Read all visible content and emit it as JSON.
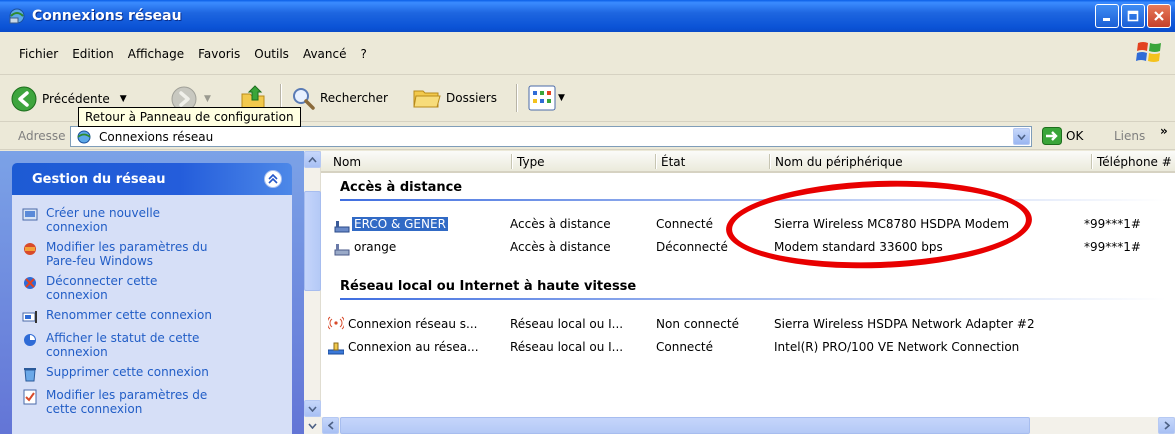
{
  "window": {
    "title": "Connexions réseau"
  },
  "menu": [
    "Fichier",
    "Edition",
    "Affichage",
    "Favoris",
    "Outils",
    "Avancé",
    "?"
  ],
  "toolbar": {
    "back_label": "Précédente",
    "search_label": "Rechercher",
    "folders_label": "Dossiers",
    "tooltip": "Retour à Panneau de configuration"
  },
  "address": {
    "label": "Adresse",
    "value": "Connexions réseau",
    "go_label": "OK",
    "links_label": "Liens",
    "more": "»"
  },
  "sidebar": {
    "title": "Gestion du réseau",
    "tasks": [
      {
        "label": "Créer une nouvelle connexion",
        "icon": "new-connection-icon"
      },
      {
        "label": "Modifier les paramètres du Pare-feu Windows",
        "icon": "firewall-icon"
      },
      {
        "label": "Déconnecter cette connexion",
        "icon": "disconnect-icon"
      },
      {
        "label": "Renommer cette connexion",
        "icon": "rename-icon"
      },
      {
        "label": "Afficher le statut de cette connexion",
        "icon": "status-icon"
      },
      {
        "label": "Supprimer cette connexion",
        "icon": "delete-icon"
      },
      {
        "label": "Modifier les paramètres de cette connexion",
        "icon": "settings-icon"
      }
    ]
  },
  "columns": [
    "Nom",
    "Type",
    "État",
    "Nom du périphérique",
    "Téléphone #"
  ],
  "groups": [
    {
      "title": "Accès à distance",
      "rows": [
        {
          "name": "ERCO & GENER",
          "type": "Accès à distance",
          "state": "Connecté",
          "device": "Sierra Wireless MC8780 HSDPA Modem",
          "phone": "*99***1#",
          "selected": true
        },
        {
          "name": "orange",
          "type": "Accès à distance",
          "state": "Déconnecté",
          "device": "Modem standard 33600 bps",
          "phone": "*99***1#",
          "selected": false
        }
      ]
    },
    {
      "title": "Réseau local ou Internet à haute vitesse",
      "rows": [
        {
          "name": "Connexion réseau s...",
          "type": "Réseau local ou I...",
          "state": "Non connecté",
          "device": "Sierra Wireless HSDPA Network Adapter #2",
          "phone": ""
        },
        {
          "name": "Connexion au résea...",
          "type": "Réseau local ou I...",
          "state": "Connecté",
          "device": "Intel(R) PRO/100 VE Network Connection",
          "phone": ""
        }
      ]
    }
  ]
}
